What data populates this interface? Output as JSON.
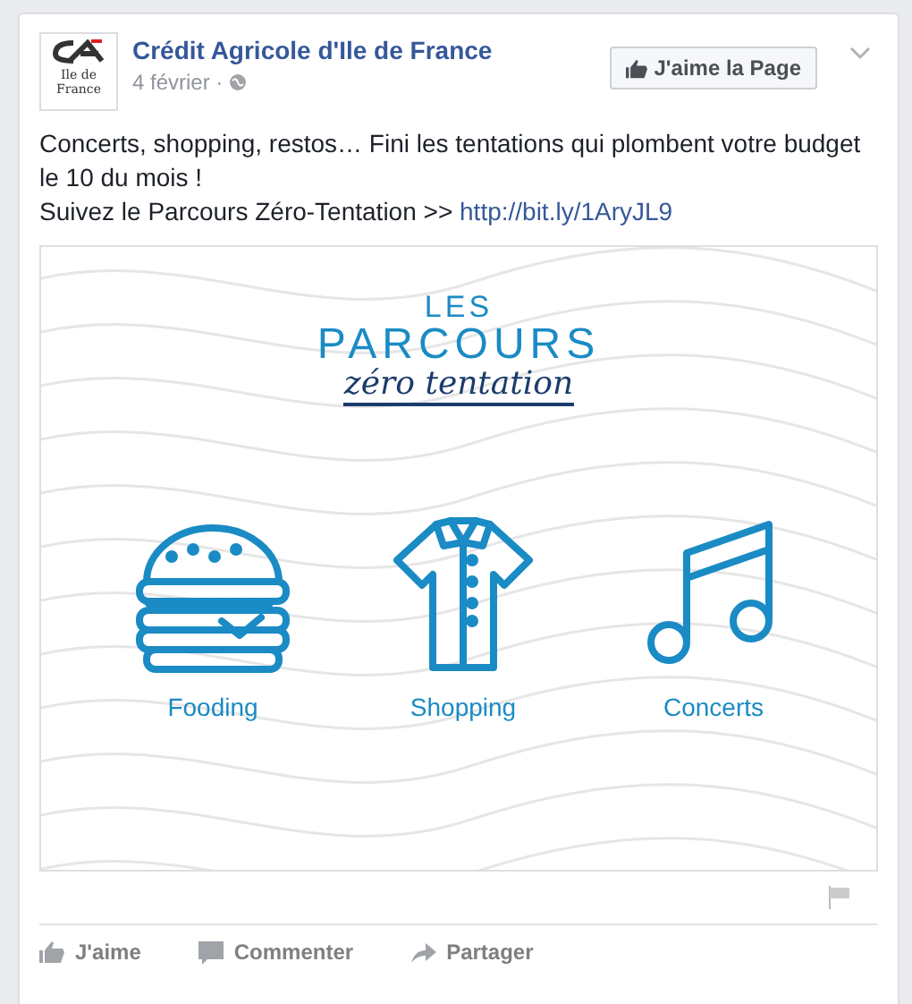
{
  "post": {
    "page_name": "Crédit Agricole d'Ile de France",
    "logo_text": "Ile de France",
    "date": "4 février ·",
    "like_page_button": "J'aime la Page",
    "text_lines": [
      "Concerts, shopping, restos… Fini les tentations qui plombent votre budget le 10 du mois !"
    ],
    "link_prefix": "Suivez le Parcours Zéro-Tentation >>",
    "link": "http://bit.ly/1AryJL9"
  },
  "graphic": {
    "title_small": "LES",
    "title_big": "PARCOURS",
    "title_script": "zéro tentation",
    "items": [
      {
        "kind": "burger",
        "label": "Fooding"
      },
      {
        "kind": "shirt",
        "label": "Shopping"
      },
      {
        "kind": "note",
        "label": "Concerts"
      }
    ]
  },
  "actions": [
    {
      "kind": "like",
      "label": "J'aime"
    },
    {
      "kind": "comment",
      "label": "Commenter"
    },
    {
      "kind": "share",
      "label": "Partager"
    }
  ]
}
